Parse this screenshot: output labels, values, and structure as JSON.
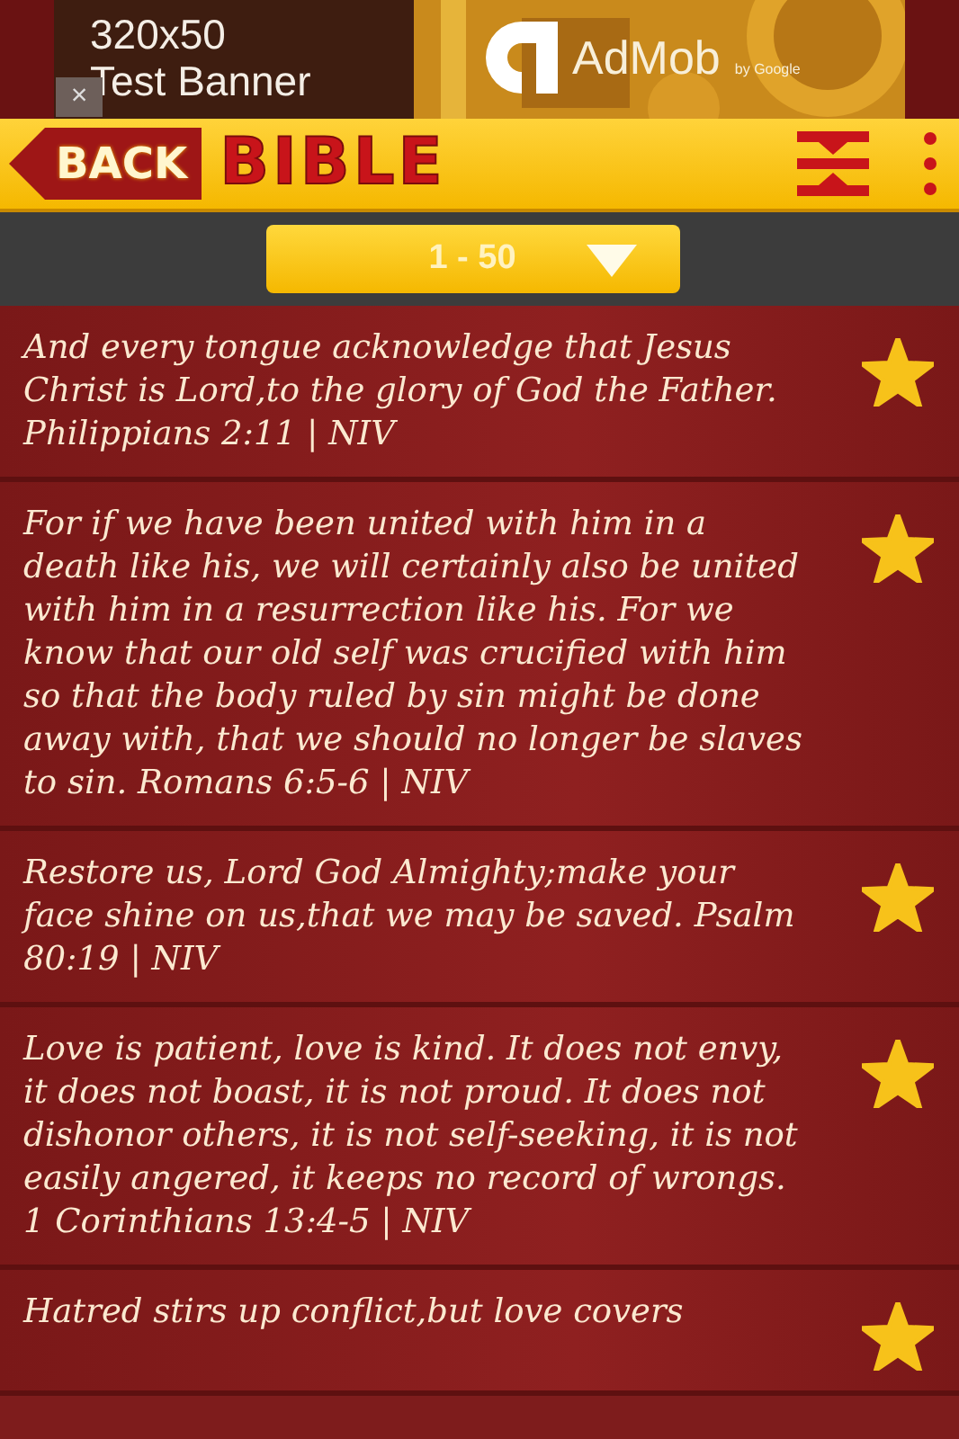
{
  "ad_banner": {
    "size_label": "320x50",
    "label": "Test Banner",
    "close": "×",
    "brand": "AdMob",
    "brand_sub": "by Google"
  },
  "header": {
    "back": "BACK",
    "title": "BIBLE"
  },
  "range_selector": {
    "value": "1 - 50"
  },
  "verses": [
    {
      "text": "And every tongue acknowledge that Jesus Christ is Lord,to the glory of God the Father. Philippians 2:11 | NIV",
      "favorite": true
    },
    {
      "text": "For if we have been united with him in a death like his, we will certainly also be united with him in a resurrection like his. For we know that our old self was crucified with him so that the body ruled by sin might be done away with, that we should no longer be slaves to sin. Romans 6:5-6 | NIV",
      "favorite": true
    },
    {
      "text": "Restore us, Lord God Almighty;make your face shine on us,that we may be saved. Psalm 80:19 | NIV",
      "favorite": true
    },
    {
      "text": "Love is patient, love is kind. It does not envy, it does not boast, it is not proud. It does not dishonor others, it is not self-seeking, it is not easily angered, it keeps no record of wrongs. 1 Corinthians 13:4-5 | NIV",
      "favorite": true
    },
    {
      "text": "Hatred stirs up conflict,but love covers",
      "favorite": true
    }
  ]
}
